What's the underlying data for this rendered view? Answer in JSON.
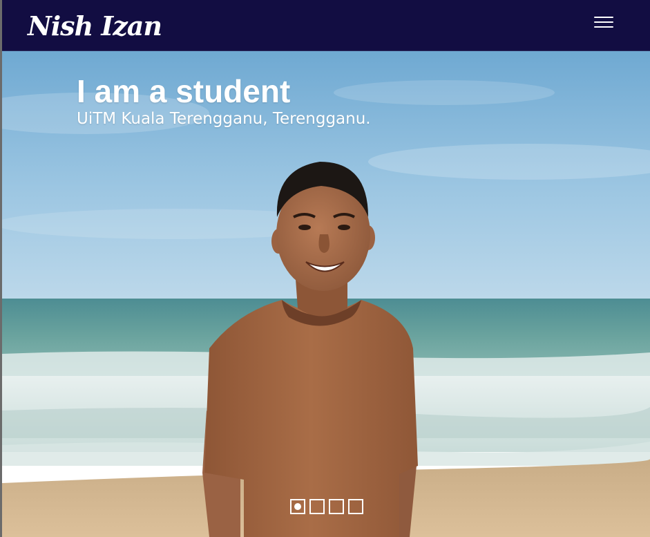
{
  "header": {
    "brand": "Nish Izan",
    "menu_icon": "hamburger-menu-icon"
  },
  "colors": {
    "nav_bg": "#120d42",
    "sky_top": "#7fb6da",
    "sky_bottom": "#b9d7ea",
    "sea": "#5f9a98",
    "sand": "#d4b489",
    "shirt": "#a86a44"
  },
  "hero": {
    "title": "I am a student",
    "subtitle": "UiTM Kuala Terengganu, Terengganu."
  },
  "carousel": {
    "slide_count": 4,
    "active_index": 0,
    "indicator_icon": "carousel-indicator"
  }
}
